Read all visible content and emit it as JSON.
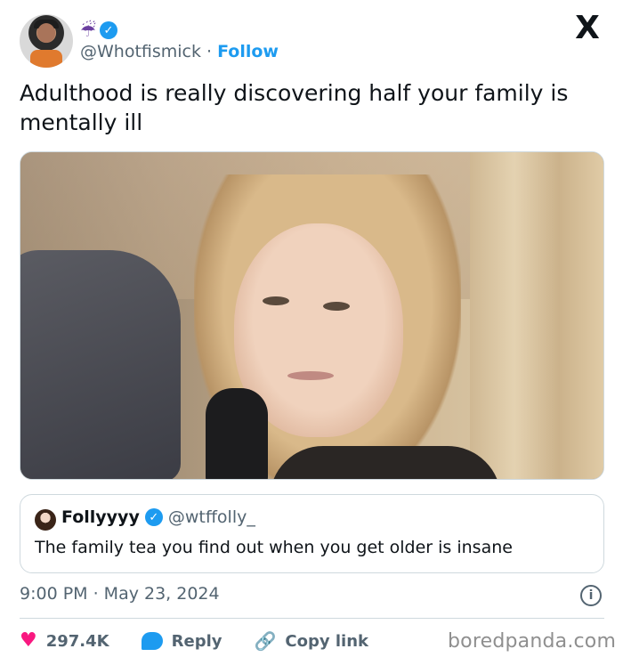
{
  "author": {
    "emoji": "☔",
    "handle": "@Whotfismick",
    "separator": "·",
    "follow_label": "Follow",
    "verified_mark": "✓"
  },
  "platform_logo": "X",
  "tweet": {
    "text": "Adulthood is really discovering half your family is mentally ill"
  },
  "quoted_tweet": {
    "name": "Follyyyy",
    "verified_mark": "✓",
    "handle": "@wtffolly_",
    "text": "The family tea you find out when you get older is insane"
  },
  "timestamp": "9:00 PM · May 23, 2024",
  "info_glyph": "i",
  "actions": {
    "likes_count": "297.4K",
    "reply_label": "Reply",
    "copy_link_label": "Copy link"
  },
  "watermark": "boredpanda.com",
  "colors": {
    "accent": "#1d9bf0",
    "like": "#f91880",
    "text": "#0f1419",
    "secondary": "#536471"
  }
}
